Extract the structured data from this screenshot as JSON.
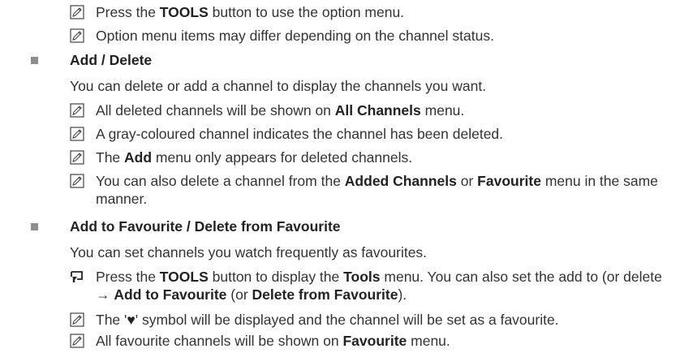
{
  "notes_top": [
    {
      "t1": "Press the ",
      "b1": "TOOLS",
      "t2": " button to use the option menu."
    },
    {
      "t1": "Option menu items may differ depending on the channel status."
    }
  ],
  "add_delete": {
    "title": "Add / Delete",
    "intro": "You can delete or add a channel to display the channels you want.",
    "notes": [
      {
        "t1": "All deleted channels will be shown on ",
        "b1": "All Channels",
        "t2": " menu."
      },
      {
        "t1": "A gray-coloured channel indicates the channel has been deleted."
      },
      {
        "t1": "The ",
        "b1": "Add",
        "t2": " menu only appears for deleted channels."
      },
      {
        "t1": "You can also delete a channel from the ",
        "b1": "Added Channels",
        "t2": " or ",
        "b2": "Favourite",
        "t3": " menu in the same",
        "cont": "manner."
      }
    ]
  },
  "favourite": {
    "title": "Add to Favourite / Delete from Favourite",
    "intro": "You can set channels you watch frequently as favourites.",
    "tools_note": {
      "t1": "Press the ",
      "b1": "TOOLS",
      "t2": " button to display the ",
      "b2": "Tools",
      "t3": " menu. You can also set the add to (or delete",
      "c1": "→ ",
      "cb1": "Add to Favourite",
      "c2": " (or ",
      "cb2": "Delete from Favourite",
      "c3": ")."
    },
    "notes": [
      {
        "t1": "The '",
        "sym": "♥",
        "t2": "' symbol will be displayed and the channel will be set as a favourite."
      },
      {
        "t1": "All favourite channels will be shown on ",
        "b1": "Favourite",
        "t2": " menu."
      }
    ]
  },
  "colors": {
    "text": "#333333",
    "bullet": "#8e8e8e",
    "heading": "#222222"
  },
  "icons": {
    "note": "note-pencil-icon",
    "tools": "tools-remote-icon",
    "bullet": "square-bullet-icon"
  }
}
